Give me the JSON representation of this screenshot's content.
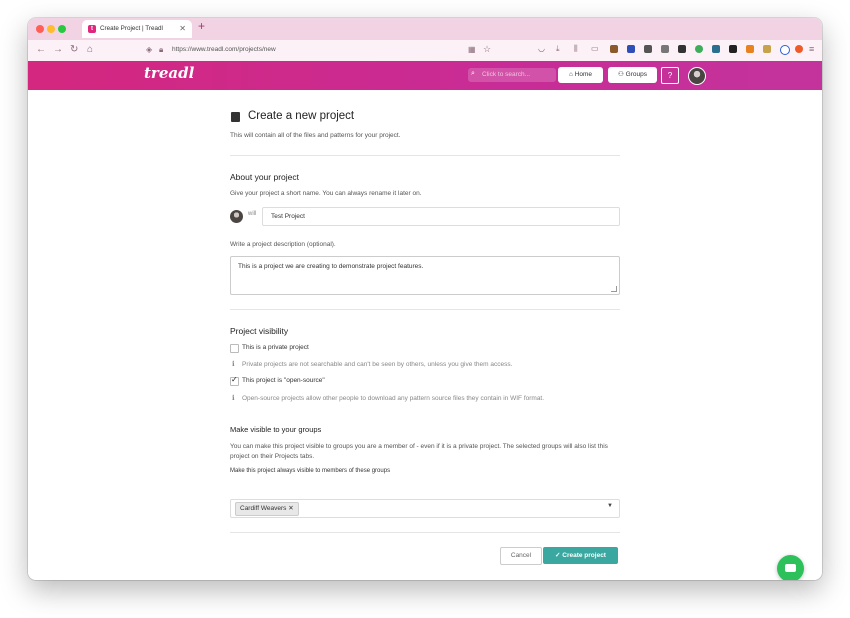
{
  "browser": {
    "tab_title": "Create Project | Treadl",
    "url": "https://www.treadl.com/projects/new"
  },
  "header": {
    "logo": "treadl",
    "search_placeholder": "Click to search...",
    "home_label": "Home",
    "groups_label": "Groups",
    "help_label": "?"
  },
  "page": {
    "title": "Create a new project",
    "subtitle": "This will contain all of the files and patterns for your project."
  },
  "about": {
    "heading": "About your project",
    "name_hint": "Give your project a short name. You can always rename it later on.",
    "owner": "will",
    "name_value": "Test Project",
    "desc_hint": "Write a project description (optional).",
    "desc_value": "This is a project we are creating to demonstrate project features."
  },
  "visibility": {
    "heading": "Project visibility",
    "private_label": "This is a private project",
    "private_checked": false,
    "private_info": "Private projects are not searchable and can't be seen by others, unless you give them access.",
    "opensource_label": "This project is \"open-source\"",
    "opensource_checked": true,
    "opensource_info": "Open-source projects allow other people to download any pattern source files they contain in WIF format."
  },
  "groups": {
    "heading": "Make visible to your groups",
    "description": "You can make this project visible to groups you are a member of - even if it is a private project. The selected groups will also list this project on their Projects tabs.",
    "field_label": "Make this project always visible to members of these groups",
    "selected": [
      "Cardiff Weavers"
    ]
  },
  "actions": {
    "cancel_label": "Cancel",
    "create_label": "Create project"
  },
  "colors": {
    "header_start": "#d4277f",
    "header_end": "#c4339c",
    "primary_button": "#3aa8a0",
    "chat_button": "#2ec05b"
  },
  "icons": [
    "book-icon",
    "search-icon",
    "home-icon",
    "groups-icon",
    "info-icon",
    "check-icon",
    "chevron-down-icon",
    "chat-icon"
  ]
}
